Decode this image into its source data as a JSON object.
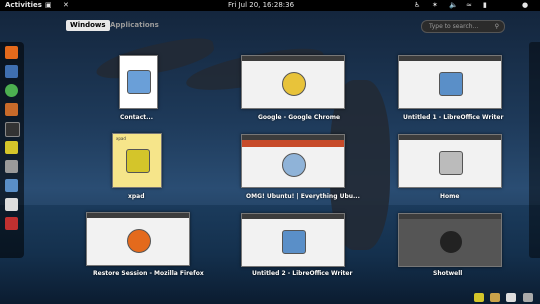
{
  "topbar": {
    "activities": "Activities",
    "datetime": "Fri Jul 20, 16:28:36"
  },
  "overview": {
    "tabs": [
      "Windows",
      "Applications"
    ],
    "search_placeholder": "Type to search..."
  },
  "windows": [
    {
      "caption": "Contact..."
    },
    {
      "caption": "Google - Google Chrome"
    },
    {
      "caption": "Untitled 1 - LibreOffice Writer"
    },
    {
      "caption": "xpad",
      "title": "xpad"
    },
    {
      "caption": "OMG! Ubuntu! | Everything Ubu..."
    },
    {
      "caption": "Home"
    },
    {
      "caption": "Restore Session - Mozilla Firefox"
    },
    {
      "caption": "Untitled 2 - LibreOffice Writer"
    },
    {
      "caption": "Shotwell"
    }
  ],
  "dash_apps": [
    "firefox",
    "thunderbird",
    "chrome",
    "ubuntu-software",
    "terminal",
    "xpad",
    "settings",
    "libreoffice-writer",
    "calculator",
    "ubuntu-one"
  ],
  "colors": {
    "topbar": "#000000",
    "selected_tab": "#e8e8e8",
    "accent": "#2a4d73"
  }
}
